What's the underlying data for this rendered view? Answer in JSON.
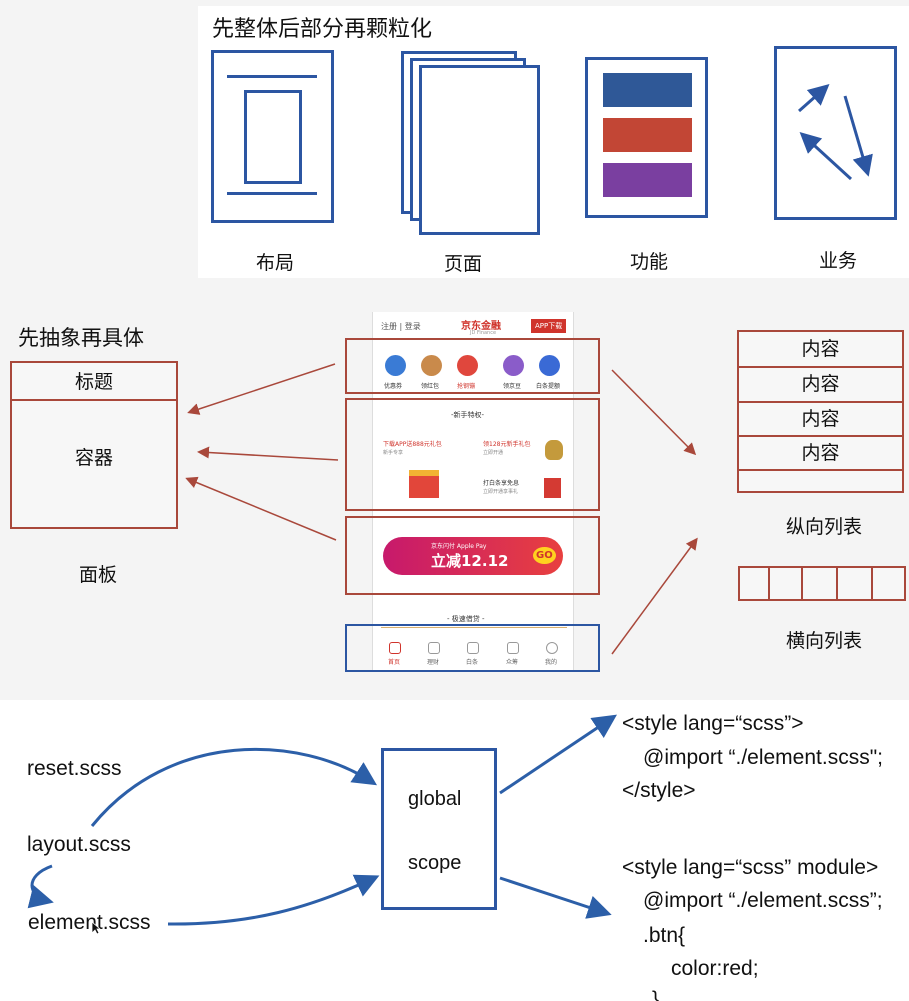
{
  "section1": {
    "title": "先整体后部分再颗粒化",
    "labels": [
      "布局",
      "页面",
      "功能",
      "业务"
    ]
  },
  "section2": {
    "title": "先抽象再具体",
    "panel": {
      "header": "标题",
      "body": "容器",
      "caption": "面板"
    },
    "vertical_list": {
      "items": [
        "内容",
        "内容",
        "内容",
        "内容"
      ],
      "caption": "纵向列表"
    },
    "horizontal_list": {
      "caption": "横向列表"
    },
    "app": {
      "top_left": "注册 | 登录",
      "brand": "京东金融",
      "brand_sub": "JD Finance",
      "download": "APP下载",
      "icons": [
        {
          "label": "优惠券",
          "color": "#3a7bd5"
        },
        {
          "label": "领红包",
          "color": "#c98a4b"
        },
        {
          "label": "抢钢镚",
          "color": "#e0473d"
        },
        {
          "label": "领京豆",
          "color": "#8a5cc9"
        },
        {
          "label": "白条提额",
          "color": "#3a6ad5"
        }
      ],
      "newbie_title": "-新手特权-",
      "offer1": "下载APP送888元礼包",
      "offer1_sub": "新手专享",
      "offer2": "领128元新手礼包",
      "offer2_sub": "立即开通",
      "offer3": "打白条享免息",
      "offer3_sub": "立即开通享事礼",
      "banner_small": "京东闪付 Apple Pay",
      "banner_big": "立减12.12",
      "banner_go": "GO",
      "loan_title": "- 极速借贷 -",
      "nav": [
        "首页",
        "理财",
        "白条",
        "众筹",
        "我的"
      ]
    }
  },
  "section3": {
    "sources": [
      "reset.scss",
      "layout.scss",
      "element.scss"
    ],
    "center": [
      "global",
      "scope"
    ],
    "code1": [
      "<style lang=“scss”>",
      "@import “./element.scss\";",
      "</style>"
    ],
    "code2": [
      "<style lang=“scss” module>",
      "@import “./element.scss”;",
      ".btn{",
      "color:red;",
      "}"
    ]
  },
  "colors": {
    "blue": "#2c56a2",
    "red": "#a9483b",
    "purple": "#7a3fa0"
  }
}
